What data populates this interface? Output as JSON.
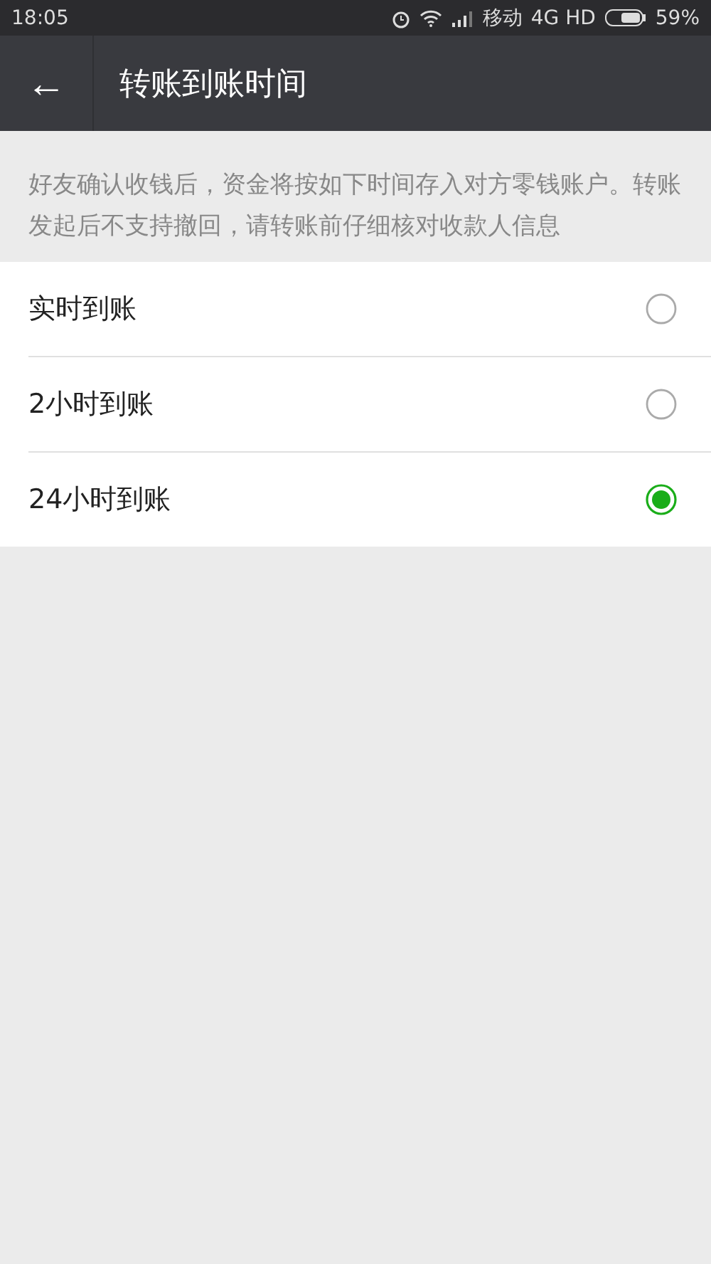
{
  "status_bar": {
    "time": "18:05",
    "carrier": "移动",
    "network": "4G HD",
    "battery": "59%"
  },
  "header": {
    "back": "←",
    "title": "转账到账时间"
  },
  "notice": "好友确认收钱后，资金将按如下时间存入对方零钱账户。转账发起后不支持撤回，请转账前仔细核对收款人信息",
  "options": [
    {
      "label": "实时到账",
      "selected": false
    },
    {
      "label": "2小时到账",
      "selected": false
    },
    {
      "label": "24小时到账",
      "selected": true
    }
  ]
}
